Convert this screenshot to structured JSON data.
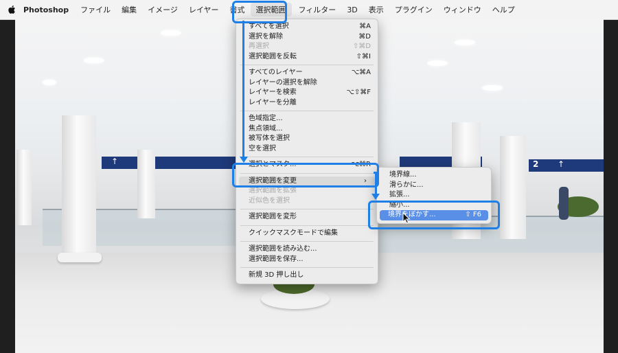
{
  "menubar": {
    "app": "Photoshop",
    "items": [
      "ファイル",
      "編集",
      "イメージ",
      "レイヤー",
      "書式",
      "選択範囲",
      "フィルター",
      "3D",
      "表示",
      "プラグイン",
      "ウィンドウ",
      "ヘルプ"
    ]
  },
  "select_menu": {
    "groups": [
      [
        {
          "label": "すべてを選択",
          "shortcut": "⌘A"
        },
        {
          "label": "選択を解除",
          "shortcut": "⌘D"
        },
        {
          "label": "再選択",
          "shortcut": "⇧⌘D",
          "disabled": true
        },
        {
          "label": "選択範囲を反転",
          "shortcut": "⇧⌘I"
        }
      ],
      [
        {
          "label": "すべてのレイヤー",
          "shortcut": "⌥⌘A"
        },
        {
          "label": "レイヤーの選択を解除",
          "shortcut": ""
        },
        {
          "label": "レイヤーを検索",
          "shortcut": "⌥⇧⌘F"
        },
        {
          "label": "レイヤーを分離",
          "shortcut": ""
        }
      ],
      [
        {
          "label": "色域指定...",
          "shortcut": ""
        },
        {
          "label": "焦点領域...",
          "shortcut": ""
        },
        {
          "label": "被写体を選択",
          "shortcut": ""
        },
        {
          "label": "空を選択",
          "shortcut": ""
        }
      ],
      [
        {
          "label": "選択とマスク...",
          "shortcut": "⌥⌘R"
        }
      ],
      [
        {
          "label": "選択範囲を変更",
          "shortcut": "",
          "submenu": true,
          "highlighted": true
        },
        {
          "label": "選択範囲を拡張",
          "shortcut": "",
          "disabled": true
        },
        {
          "label": "近似色を選択",
          "shortcut": "",
          "disabled": true
        }
      ],
      [
        {
          "label": "選択範囲を変形",
          "shortcut": ""
        }
      ],
      [
        {
          "label": "クイックマスクモードで編集",
          "shortcut": ""
        }
      ],
      [
        {
          "label": "選択範囲を読み込む...",
          "shortcut": ""
        },
        {
          "label": "選択範囲を保存...",
          "shortcut": ""
        }
      ],
      [
        {
          "label": "新規 3D 押し出し",
          "shortcut": ""
        }
      ]
    ]
  },
  "modify_submenu": {
    "items": [
      {
        "label": "境界線...",
        "shortcut": ""
      },
      {
        "label": "滑らかに...",
        "shortcut": ""
      },
      {
        "label": "拡張...",
        "shortcut": ""
      },
      {
        "label": "縮小...",
        "shortcut": ""
      },
      {
        "label": "境界をぼかす...",
        "shortcut": "⇧ F6",
        "selected": true
      }
    ]
  },
  "signs": [
    "↑",
    "2",
    "↑"
  ],
  "colors": {
    "annotation": "#1e7fe6",
    "selection": "#5a8fe8"
  }
}
